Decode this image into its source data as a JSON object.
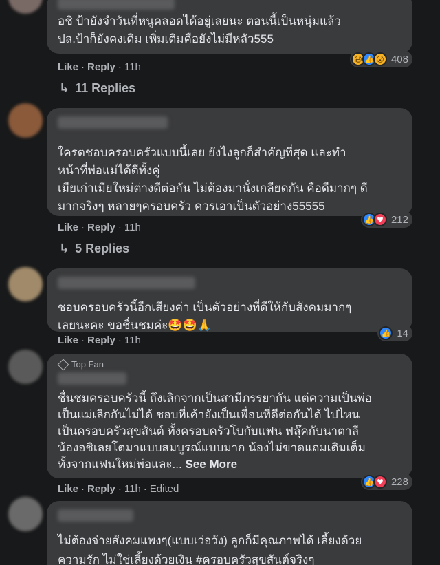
{
  "comments": [
    {
      "text": "อชิ ป้ายังจำวันที่หนูคลอดได้อยู่เลยนะ ตอนนี้เป็นหนุ่มแล้ว\nปล.ป้าก็ยังคงเดิม เพิ่มเติมคือยังไม่มีหลัว555",
      "like": "Like",
      "reply": "Reply",
      "time": "11h",
      "reaction_count": "408",
      "replies": "11 Replies"
    },
    {
      "text": "ใครตชอบครอบครัวแบบนี้เลย ยังไงลูกก็สำคัญที่สุด และทำ\nหน้าที่พ่อแม่ได้ดีทั้งคู่\nเมียเก่าเมียใหม่ต่างดีต่อกัน ไม่ต้องมานั่งเกลียดกัน คือดีมากๆ ดี\nมากจริงๆ หลายๆครอบครัว ควรเอาเป็นตัวอย่าง55555",
      "like": "Like",
      "reply": "Reply",
      "time": "11h",
      "reaction_count": "212",
      "replies": "5 Replies"
    },
    {
      "text": "ชอบครอบครัวนี้อีกเสียงค่า เป็นตัวอย่างที่ดีให้กับสังคมมากๆ\nเลยนะคะ ขอชื่นชมค่ะ",
      "text_emoji": "🤩🤩🙏",
      "like": "Like",
      "reply": "Reply",
      "time": "11h",
      "reaction_count": "14"
    },
    {
      "badge": "Top Fan",
      "text": "ชื่นชมครอบครัวนี้ ถึงเลิกจากเป็นสามีภรรยากัน แต่ความเป็นพ่อ\nเป็นแม่เลิกกันไม่ได้ ชอบที่เค้ายังเป็นเพื่อนที่ดีต่อกันได้ ไปไหน\nเป็นครอบครัวสุขสันต์ ทั้งครอบครัวโบกับแฟน ฟลุ๊คกับนาตาลี\nน้องอชิเลยโตมาแบบสมบูรณ์แบบมาก น้องไม่ขาดแถมเติมเต็ม\nทั้งจากแฟนใหม่พ่อและ...",
      "see_more": "See More",
      "like": "Like",
      "reply": "Reply",
      "time": "11h",
      "edited": "Edited",
      "reaction_count": "228"
    },
    {
      "text": "ไม่ต้องจ่ายสังคมแพงๆ(แบบเว่อวัง) ลูกก็มีคุณภาพได้ เลี้ยงด้วย\nความรัก ไม่ใช่เลี้ยงด้วยเงิน #ครอบครัวสุขสันต์จริงๆ"
    }
  ],
  "icons": {
    "like": "👍",
    "love": "♥",
    "haha": "😆",
    "wow": "😮",
    "reply_arrow": "↳"
  },
  "colors": {
    "background": "#18191a",
    "bubble": "#3a3b3c",
    "like": "#2d88ff",
    "love": "#f33e58",
    "haha": "#f7b125"
  }
}
